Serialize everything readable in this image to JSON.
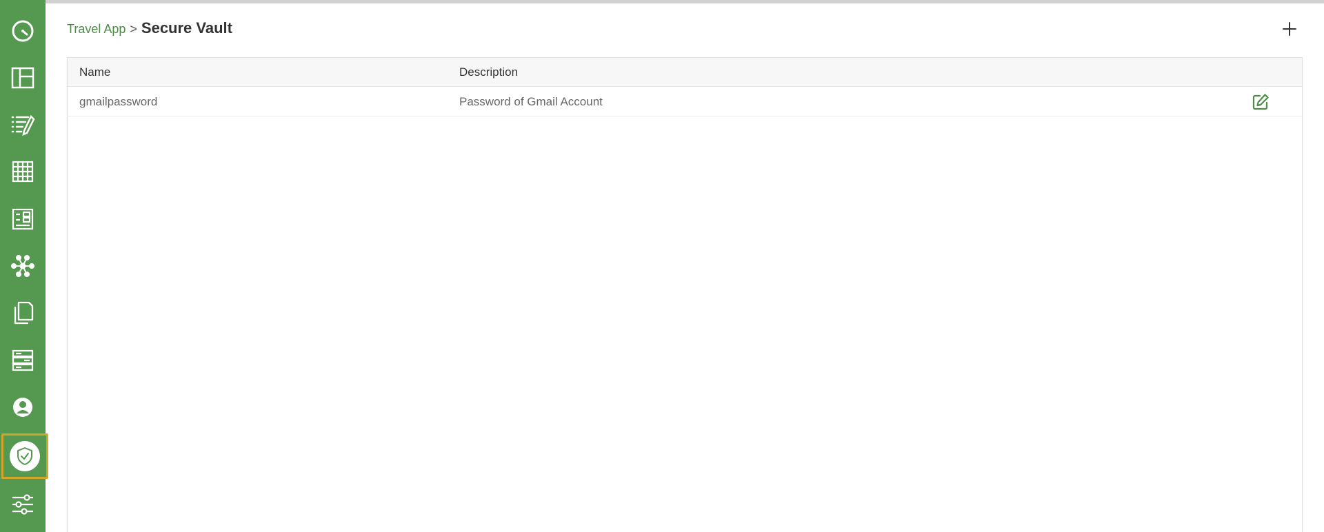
{
  "breadcrumb": {
    "app_link": "Travel App",
    "separator": ">",
    "current": "Secure Vault"
  },
  "sidebar": {
    "items": [
      {
        "icon": "gauge-icon"
      },
      {
        "icon": "layout-icon"
      },
      {
        "icon": "list-edit-icon"
      },
      {
        "icon": "table-icon"
      },
      {
        "icon": "form-icon"
      },
      {
        "icon": "network-icon"
      },
      {
        "icon": "documents-icon"
      },
      {
        "icon": "server-icon"
      },
      {
        "icon": "user-circle-icon"
      },
      {
        "icon": "shield-check-icon",
        "active": true
      },
      {
        "icon": "sliders-icon"
      }
    ]
  },
  "table": {
    "headers": {
      "name": "Name",
      "description": "Description"
    },
    "rows": [
      {
        "name": "gmailpassword",
        "description": "Password of Gmail Account"
      }
    ]
  },
  "colors": {
    "sidebar": "#55984f",
    "accent": "#4e8a48",
    "active_border": "#d4a52b"
  }
}
